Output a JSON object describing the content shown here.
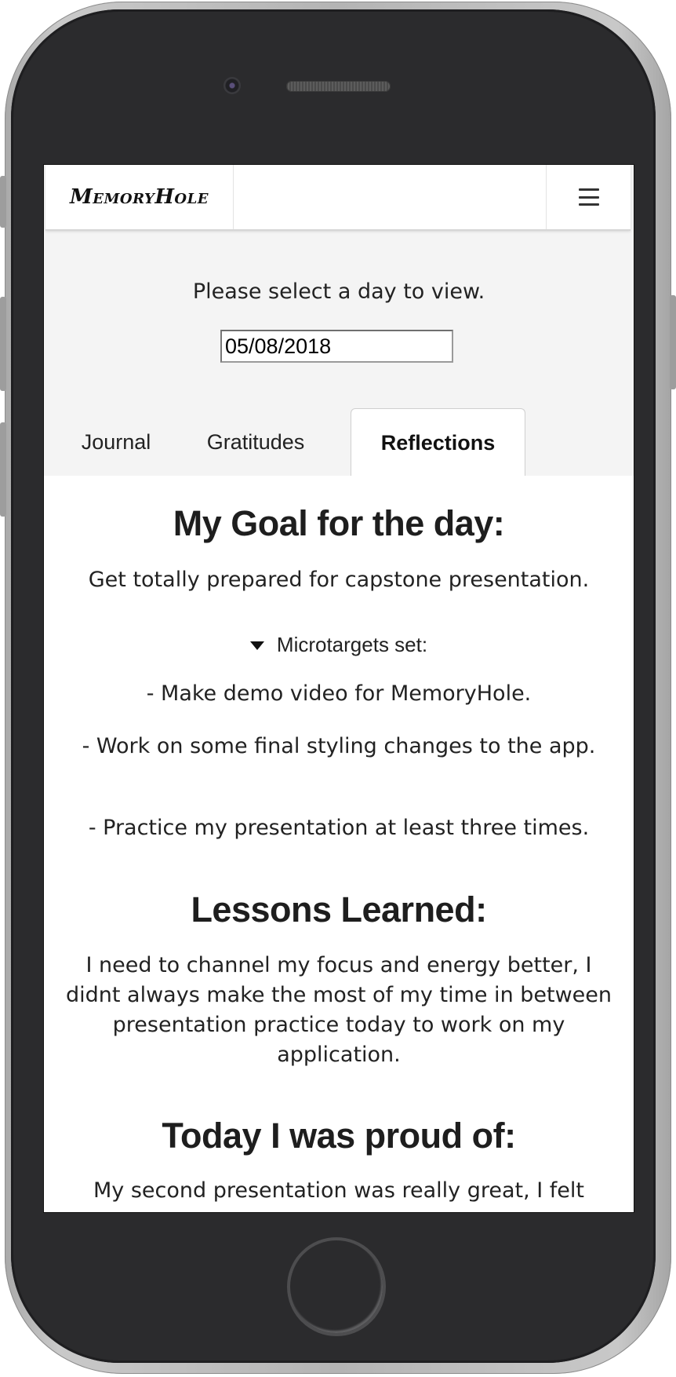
{
  "app": {
    "brand": "MemoryHole",
    "menu_icon": "hamburger-icon"
  },
  "date_picker": {
    "prompt": "Please select a day to view.",
    "value": "05/08/2018"
  },
  "tabs": [
    {
      "label": "Journal",
      "active": false
    },
    {
      "label": "Gratitudes",
      "active": false
    },
    {
      "label": "Reflections",
      "active": true
    }
  ],
  "reflections": {
    "goal_heading": "My Goal for the day:",
    "goal_text": "Get totally prepared for capstone presentation.",
    "microtargets_label": "Microtargets set:",
    "microtargets": [
      "- Make demo video for MemoryHole.",
      "- Work on some final styling changes to the app.",
      "- Practice my presentation at least three times."
    ],
    "lessons_heading": "Lessons Learned:",
    "lessons_text": "I need to channel my focus and energy better, I didnt always make the most of my time in between presentation practice today to work on my application.",
    "proud_heading": "Today I was proud of:",
    "proud_text": "My second presentation was really great, I felt"
  }
}
